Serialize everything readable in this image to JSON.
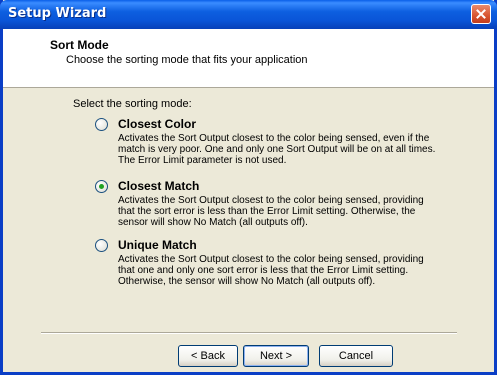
{
  "window": {
    "title": "Setup Wizard"
  },
  "header": {
    "title": "Sort Mode",
    "subtitle": "Choose the sorting mode that fits your application"
  },
  "prompt": "Select the sorting mode:",
  "options": [
    {
      "label": "Closest Color",
      "selected": false,
      "description": "Activates the Sort Output closest to the color being sensed, even if the match is very poor. One and only one Sort Output will be on at all times. The Error Limit parameter is not used."
    },
    {
      "label": "Closest Match",
      "selected": true,
      "description": "Activates the Sort Output closest to the color being sensed, providing that the sort error is less than the Error Limit setting. Otherwise, the sensor will show No Match (all outputs off)."
    },
    {
      "label": "Unique Match",
      "selected": false,
      "description": "Activates the Sort Output closest to the color being sensed, providing that one and only one sort error is less that the Error Limit setting. Otherwise, the sensor will show No Match (all outputs off)."
    }
  ],
  "buttons": {
    "back": "< Back",
    "next": "Next >",
    "cancel": "Cancel"
  },
  "colors": {
    "titlebar": "#0a5fe8",
    "close_button": "#d8552f",
    "dialog_face": "#ece9d8",
    "radio_dot": "#21a121"
  },
  "icons": {
    "close": "close-icon"
  }
}
